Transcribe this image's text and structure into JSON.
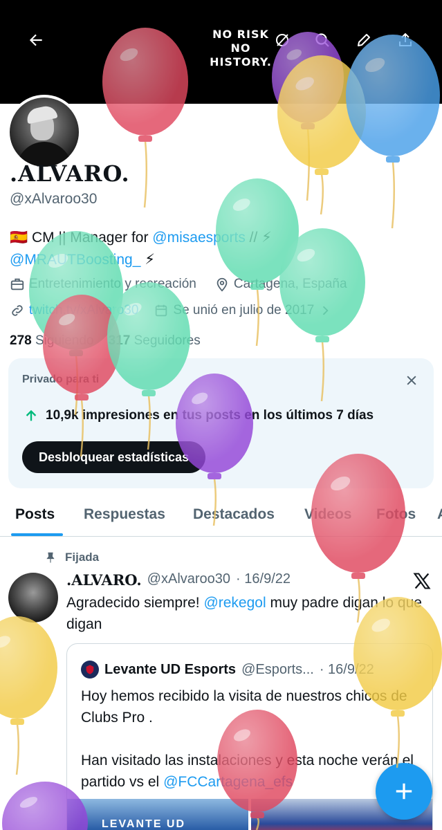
{
  "header": {
    "banner_text_line1": "NO RISK",
    "banner_text_line2": "NO HISTORY."
  },
  "profile": {
    "name": ".ALVARO.",
    "handle": "@xAlvaroo30",
    "bio_flag": "🇪🇸",
    "bio_prefix": "CM || Manager for ",
    "bio_mention1": "@misaesports",
    "bio_sep": " // ⚡",
    "bio_mention2": "@MRAUTBoosting_",
    "bio_suffix": " ⚡",
    "category": "Entretenimiento y recreación",
    "location": "Cartagena, España",
    "website": "twitch.tv/xAlvaro30",
    "joined": "Se unió en julio de 2017",
    "following_count": "278",
    "following_label": "Siguiendo",
    "followers_count": "317",
    "followers_label": "Seguidores"
  },
  "insights": {
    "label": "Privado para ti",
    "stat_value": "10,9k impresiones",
    "stat_rest": " en tus posts en los últimos 7 días",
    "button": "Desbloquear estadísticas"
  },
  "tabs": [
    "Posts",
    "Respuestas",
    "Destacados",
    "Videos",
    "Fotos",
    "A"
  ],
  "pinned_post": {
    "pinned_label": "Fijada",
    "author_name": ".ALVARO.",
    "author_handle": "@xAlvaroo30",
    "date": "· 16/9/22",
    "text_prefix": "Agradecido siempre! ",
    "text_mention": "@rekegol",
    "text_suffix": " muy padre digan lo que digan",
    "quote": {
      "author_name": "Levante UD Esports",
      "author_handle": "@Esports...",
      "date": "· 16/9/22",
      "line1": "Hoy hemos recibido la visita de nuestros chicos de Clubs Pro .",
      "line2_prefix": "Han visitado las instalaciones y esta noche verán el partido vs el ",
      "line2_mention": "@FCCartagena_efs",
      "image_text": "LEVANTE UD"
    }
  },
  "colors": {
    "accent": "#1d9bf0",
    "text": "#0f1419",
    "muted": "#536471",
    "card_bg": "#eef6fb",
    "balloon_red": "#e0485f",
    "balloon_green": "#5fdcb0",
    "balloon_blue": "#4aa0ea",
    "balloon_yellow": "#f2cb45",
    "balloon_purple": "#9446d8"
  },
  "icons": [
    "back-arrow-icon",
    "no-notifications-icon",
    "search-icon",
    "edit-icon",
    "share-icon",
    "briefcase-icon",
    "location-pin-icon",
    "link-icon",
    "calendar-icon",
    "chevron-right-icon",
    "close-icon",
    "arrow-up-icon",
    "pin-icon",
    "x-logo-icon",
    "plus-icon",
    "balloon-icon"
  ]
}
